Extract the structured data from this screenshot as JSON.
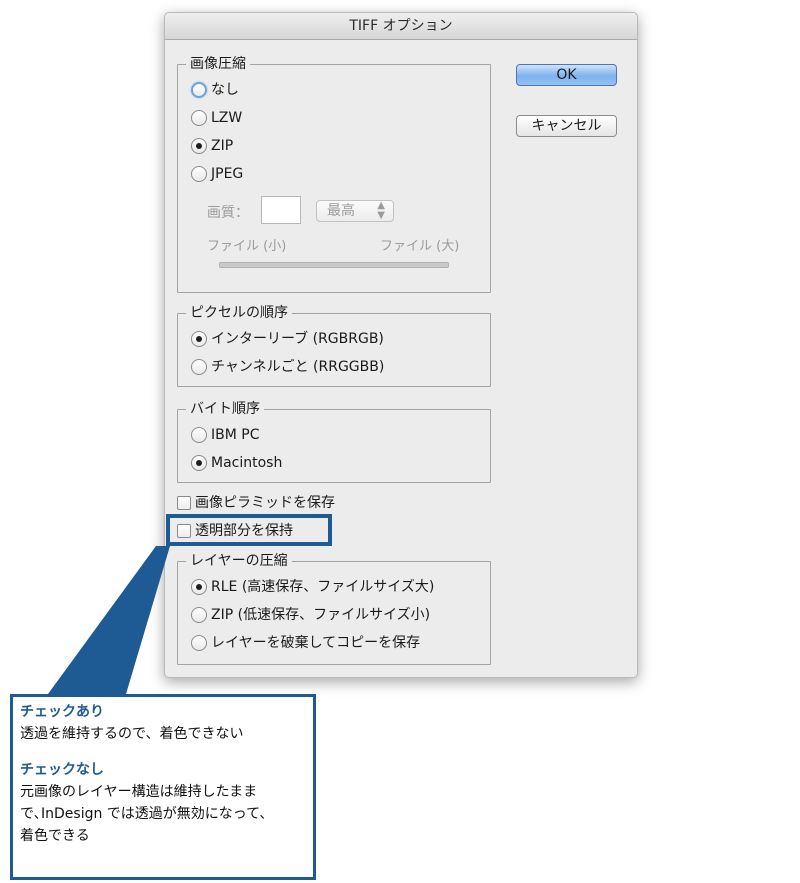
{
  "dialog": {
    "title": "TIFF オプション",
    "ok_label": "OK",
    "cancel_label": "キャンセル"
  },
  "compression": {
    "legend": "画像圧縮",
    "options": [
      "なし",
      "LZW",
      "ZIP",
      "JPEG"
    ],
    "selected": "ZIP",
    "quality_label": "画質：",
    "quality_select": "最高",
    "file_small": "ファイル (小)",
    "file_large": "ファイル (大)"
  },
  "pixel_order": {
    "legend": "ピクセルの順序",
    "options": [
      "インターリーブ (RGBRGB)",
      "チャンネルごと (RRGGBB)"
    ],
    "selected": "インターリーブ (RGBRGB)"
  },
  "byte_order": {
    "legend": "バイト順序",
    "options": [
      "IBM PC",
      "Macintosh"
    ],
    "selected": "Macintosh"
  },
  "checkboxes": {
    "save_pyramid": "画像ピラミッドを保存",
    "save_transparency": "透明部分を保持"
  },
  "layer_compression": {
    "legend": "レイヤーの圧縮",
    "options": [
      "RLE (高速保存、ファイルサイズ大)",
      "ZIP (低速保存、ファイルサイズ小)",
      "レイヤーを破棄してコピーを保存"
    ],
    "selected": "RLE (高速保存、ファイルサイズ大)"
  },
  "callout": {
    "heading_on": "チェックあり",
    "text_on": "透過を維持するので、着色できない",
    "heading_off": "チェックなし",
    "text_off_1": "元画像のレイヤー構造は維持したまま",
    "text_off_2": "で､InDesign では透過が無効になって、",
    "text_off_3": "着色できる"
  },
  "colors": {
    "callout_accent": "#1e5a93",
    "default_button": "#7fb2f0"
  }
}
